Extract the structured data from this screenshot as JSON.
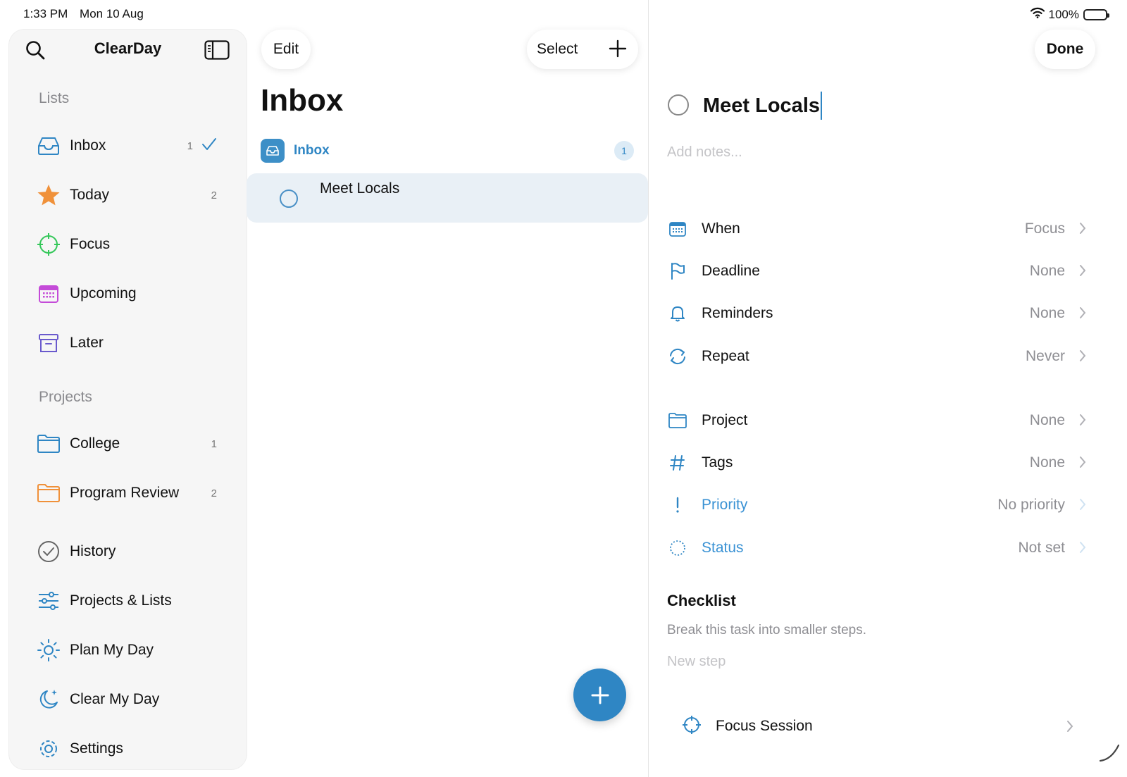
{
  "status_bar": {
    "time": "1:33 PM",
    "date": "Mon 10 Aug",
    "battery": "100%"
  },
  "sidebar": {
    "app_title": "ClearDay",
    "lists_header": "Lists",
    "lists": [
      {
        "label": "Inbox",
        "count": "1",
        "icon": "inbox-icon",
        "selected": true
      },
      {
        "label": "Today",
        "count": "2",
        "icon": "star-icon"
      },
      {
        "label": "Focus",
        "count": "",
        "icon": "crosshair-icon"
      },
      {
        "label": "Upcoming",
        "count": "",
        "icon": "calendar-icon"
      },
      {
        "label": "Later",
        "count": "",
        "icon": "archive-box-icon"
      }
    ],
    "projects_header": "Projects",
    "projects": [
      {
        "label": "College",
        "count": "1",
        "icon": "folder-icon",
        "color": "#2f86c4"
      },
      {
        "label": "Program Review",
        "count": "2",
        "icon": "folder-icon",
        "color": "#f0913a"
      }
    ],
    "extras": [
      {
        "label": "History",
        "icon": "checkmark-circle-icon"
      },
      {
        "label": "Projects & Lists",
        "icon": "sliders-icon"
      },
      {
        "label": "Plan My Day",
        "icon": "sun-icon"
      },
      {
        "label": "Clear My Day",
        "icon": "moon-stars-icon"
      },
      {
        "label": "Settings",
        "icon": "gear-icon"
      }
    ]
  },
  "middle": {
    "edit_label": "Edit",
    "select_label": "Select",
    "title": "Inbox",
    "group_label": "Inbox",
    "group_count": "1",
    "tasks": [
      {
        "title": "Meet Locals"
      }
    ]
  },
  "detail": {
    "done_label": "Done",
    "task_title": "Meet Locals",
    "notes_placeholder": "Add notes...",
    "properties": [
      {
        "label": "When",
        "value": "Focus",
        "icon": "calendar-icon"
      },
      {
        "label": "Deadline",
        "value": "None",
        "icon": "flag-icon"
      },
      {
        "label": "Reminders",
        "value": "None",
        "icon": "bell-icon"
      },
      {
        "label": "Repeat",
        "value": "Never",
        "icon": "repeat-icon"
      },
      {
        "label": "Project",
        "value": "None",
        "icon": "folder-icon"
      },
      {
        "label": "Tags",
        "value": "None",
        "icon": "hashtag-icon"
      },
      {
        "label": "Priority",
        "value": "No priority",
        "icon": "exclamation-icon"
      },
      {
        "label": "Status",
        "value": "Not set",
        "icon": "dashed-circle-icon"
      }
    ],
    "checklist_title": "Checklist",
    "checklist_subtitle": "Break this task into smaller steps.",
    "new_step_placeholder": "New step",
    "focus_session_label": "Focus Session"
  },
  "colors": {
    "accent": "#2f86c4",
    "selected_row": "#e9f0f6",
    "sidebar_bg": "#f6f6f6"
  }
}
